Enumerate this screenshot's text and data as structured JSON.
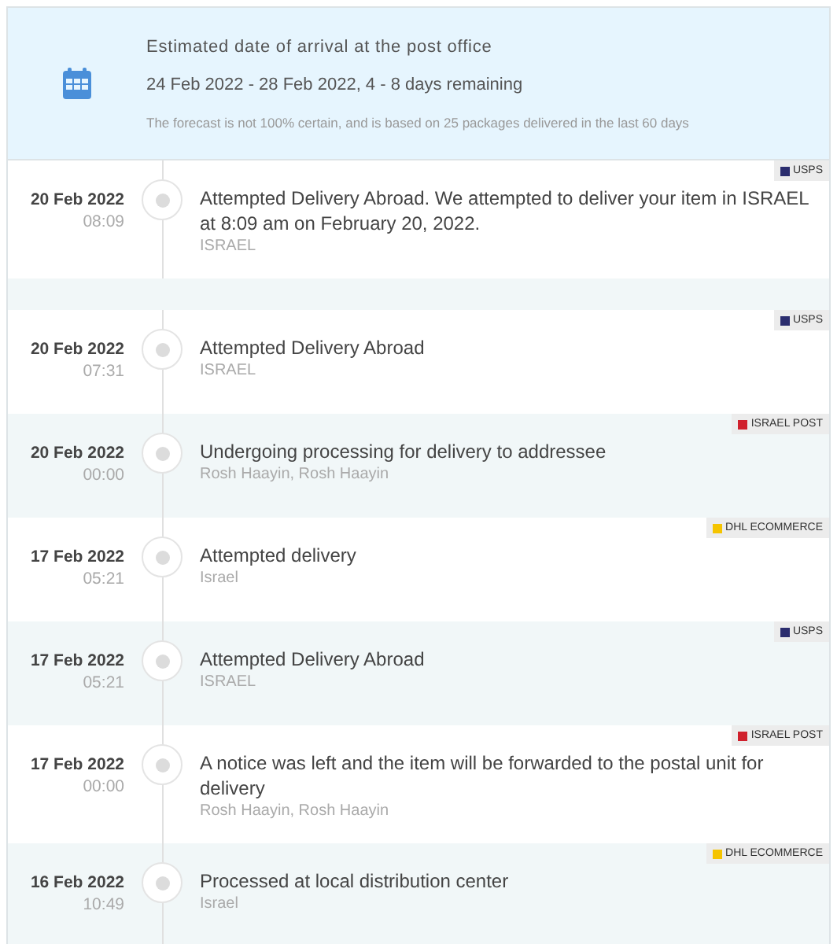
{
  "estimate": {
    "title": "Estimated date of arrival at the post office",
    "range": "24 Feb 2022 - 28 Feb 2022, 4 - 8 days remaining",
    "note": "The forecast is not 100% certain, and is based on 25 packages delivered in the last 60 days"
  },
  "events": [
    {
      "date": "20 Feb 2022",
      "time": "08:09",
      "title": "Attempted Delivery Abroad. We attempted to deliver your item in ISRAEL at 8:09 am on February 20, 2022.",
      "location": "ISRAEL",
      "carrier": "USPS",
      "color": "#2b2d6e"
    },
    {
      "date": "20 Feb 2022",
      "time": "07:31",
      "title": "Attempted Delivery Abroad",
      "location": "ISRAEL",
      "carrier": "USPS",
      "color": "#2b2d6e"
    },
    {
      "date": "20 Feb 2022",
      "time": "00:00",
      "title": "Undergoing processing for delivery to addressee",
      "location": "Rosh Haayin, Rosh Haayin",
      "carrier": "ISRAEL POST",
      "color": "#d0202c"
    },
    {
      "date": "17 Feb 2022",
      "time": "05:21",
      "title": "Attempted delivery",
      "location": "Israel",
      "carrier": "DHL ECOMMERCE",
      "color": "#f5c400"
    },
    {
      "date": "17 Feb 2022",
      "time": "05:21",
      "title": "Attempted Delivery Abroad",
      "location": "ISRAEL",
      "carrier": "USPS",
      "color": "#2b2d6e"
    },
    {
      "date": "17 Feb 2022",
      "time": "00:00",
      "title": "A notice was left and the item will be forwarded to the postal unit for delivery",
      "location": "Rosh Haayin, Rosh Haayin",
      "carrier": "ISRAEL POST",
      "color": "#d0202c"
    },
    {
      "date": "16 Feb 2022",
      "time": "10:49",
      "title": "Processed at local distribution center",
      "location": "Israel",
      "carrier": "DHL ECOMMERCE",
      "color": "#f5c400"
    }
  ]
}
